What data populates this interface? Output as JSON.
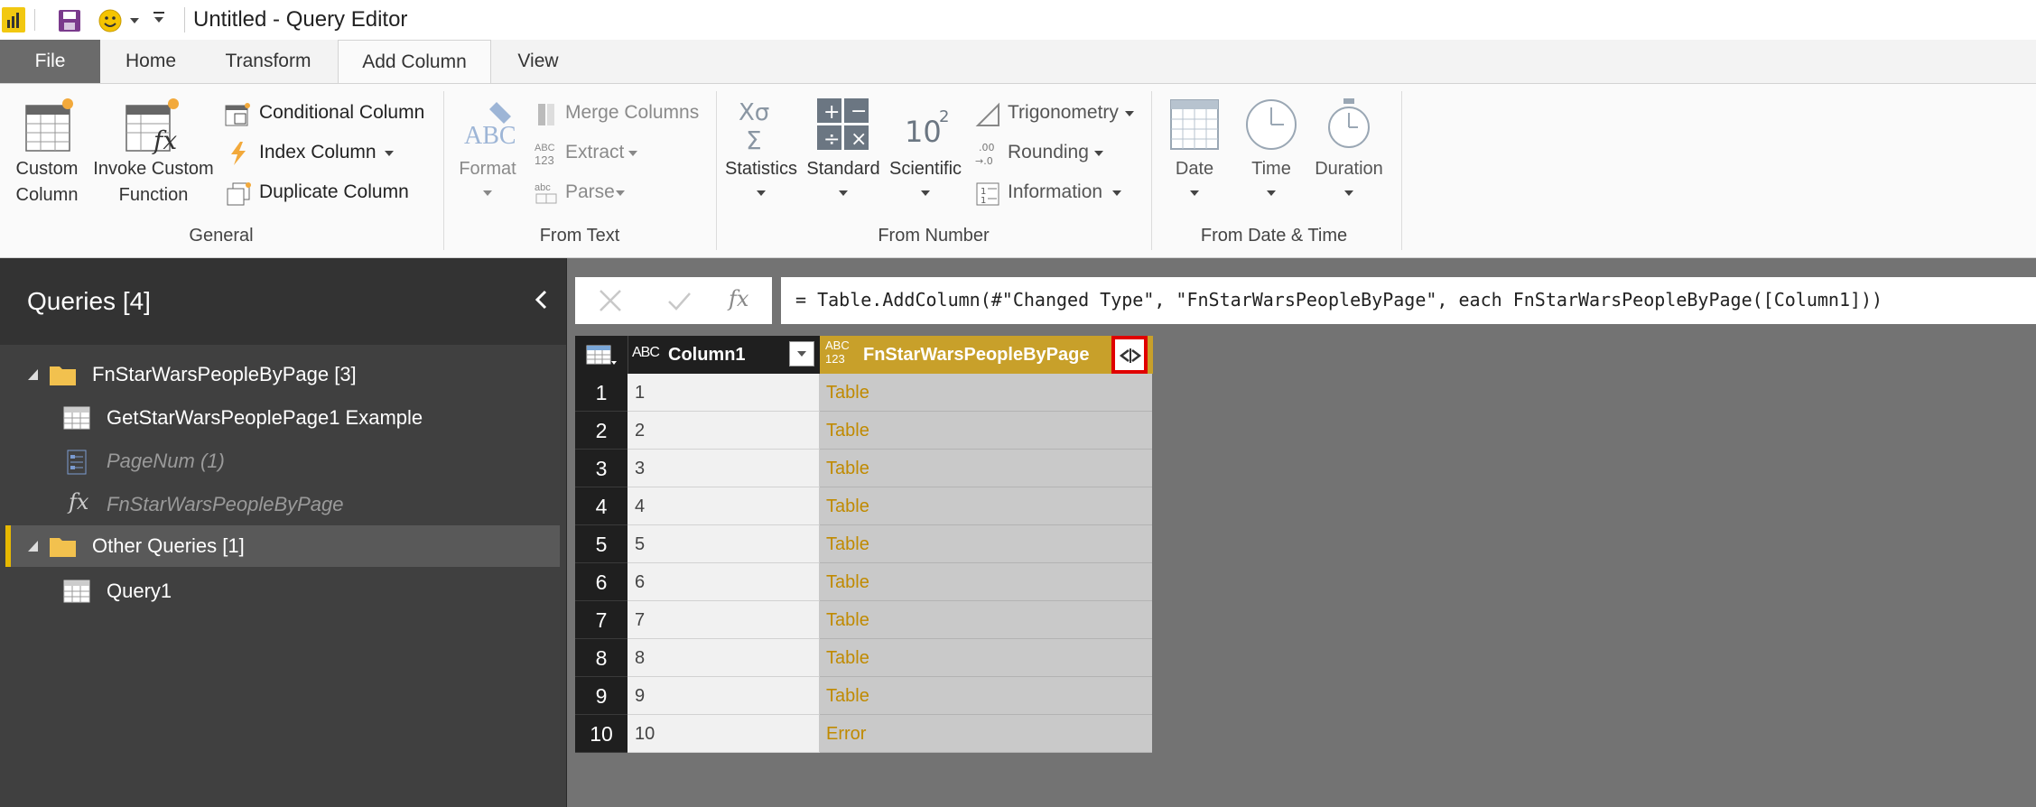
{
  "window": {
    "title": "Untitled - Query Editor"
  },
  "tabs": [
    {
      "label": "File"
    },
    {
      "label": "Home"
    },
    {
      "label": "Transform"
    },
    {
      "label": "Add Column"
    },
    {
      "label": "View"
    }
  ],
  "ribbon": {
    "general": {
      "custom_column": [
        "Custom",
        "Column"
      ],
      "invoke_custom_function": [
        "Invoke Custom",
        "Function"
      ],
      "conditional_column": "Conditional Column",
      "index_column": "Index Column",
      "duplicate_column": "Duplicate Column",
      "label": "General"
    },
    "from_text": {
      "format": "Format",
      "merge_columns": "Merge Columns",
      "extract": "Extract",
      "parse": "Parse",
      "label": "From Text"
    },
    "from_number": {
      "statistics": "Statistics",
      "standard": "Standard",
      "scientific": "Scientific",
      "trigonometry": "Trigonometry",
      "rounding": "Rounding",
      "information": "Information",
      "label": "From Number"
    },
    "from_date_time": {
      "date": "Date",
      "time": "Time",
      "duration": "Duration",
      "label": "From Date & Time"
    }
  },
  "queries": {
    "title": "Queries [4]",
    "groups": [
      {
        "name": "FnStarWarsPeopleByPage [3]",
        "items": [
          {
            "name": "GetStarWarsPeoplePage1 Example",
            "icon": "table-icon"
          },
          {
            "name": "PageNum (1)",
            "icon": "parameter-icon"
          },
          {
            "name": "FnStarWarsPeopleByPage",
            "icon": "function-icon"
          }
        ]
      },
      {
        "name": "Other Queries [1]",
        "items": [
          {
            "name": "Query1",
            "icon": "table-icon"
          }
        ]
      }
    ]
  },
  "formula_bar": {
    "fx": "fx",
    "formula": "= Table.AddColumn(#\"Changed Type\", \"FnStarWarsPeopleByPage\", each FnStarWarsPeopleByPage([Column1]))"
  },
  "grid": {
    "columns": [
      {
        "type_icon": "ABC",
        "name": "Column1"
      },
      {
        "type_icon": "ABC 123",
        "name": "FnStarWarsPeopleByPage"
      }
    ],
    "rows": [
      {
        "num": "1",
        "col1": "1",
        "col2": "Table"
      },
      {
        "num": "2",
        "col1": "2",
        "col2": "Table"
      },
      {
        "num": "3",
        "col1": "3",
        "col2": "Table"
      },
      {
        "num": "4",
        "col1": "4",
        "col2": "Table"
      },
      {
        "num": "5",
        "col1": "5",
        "col2": "Table"
      },
      {
        "num": "6",
        "col1": "6",
        "col2": "Table"
      },
      {
        "num": "7",
        "col1": "7",
        "col2": "Table"
      },
      {
        "num": "8",
        "col1": "8",
        "col2": "Table"
      },
      {
        "num": "9",
        "col1": "9",
        "col2": "Table"
      },
      {
        "num": "10",
        "col1": "10",
        "col2": "Error"
      }
    ]
  },
  "colors": {
    "accent": "#e6b800",
    "highlight_box": "#e00000",
    "column_header_yellow": "#c8a02a",
    "cell_link": "#c08a00"
  }
}
